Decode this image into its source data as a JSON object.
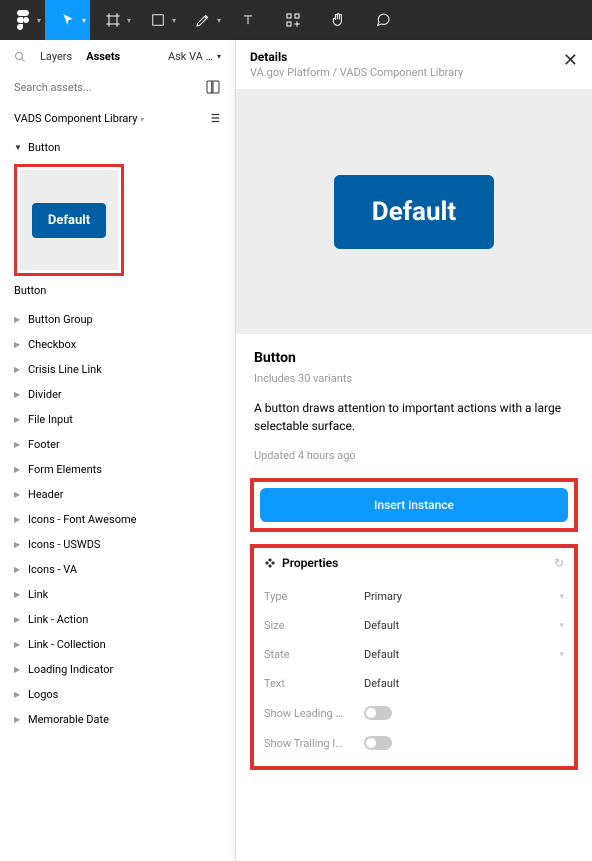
{
  "tabs": {
    "layers": "Layers",
    "assets": "Assets",
    "ask": "Ask VA …"
  },
  "search": {
    "placeholder": "Search assets..."
  },
  "library": {
    "name": "VADS Component Library"
  },
  "assets": {
    "button": "Button",
    "thumb_label": "Default",
    "thumb_caption": "Button",
    "items": [
      "Button Group",
      "Checkbox",
      "Crisis Line Link",
      "Divider",
      "File Input",
      "Footer",
      "Form Elements",
      "Header",
      "Icons - Font Awesome",
      "Icons - USWDS",
      "Icons - VA",
      "Link",
      "Link - Action",
      "Link - Collection",
      "Loading Indicator",
      "Logos",
      "Memorable Date"
    ]
  },
  "details": {
    "title": "Details",
    "breadcrumb": "VA.gov Platform / VADS Component Library",
    "preview_label": "Default",
    "name": "Button",
    "variants": "Includes 30 variants",
    "description": "A button draws attention to important actions with a large selectable surface.",
    "updated": "Updated 4 hours ago",
    "insert": "Insert instance",
    "properties": {
      "heading": "Properties",
      "rows": [
        {
          "label": "Type",
          "value": "Primary",
          "chev": true
        },
        {
          "label": "Size",
          "value": "Default",
          "chev": true
        },
        {
          "label": "State",
          "value": "Default",
          "chev": true
        },
        {
          "label": "Text",
          "value": "Default",
          "chev": false
        }
      ],
      "toggles": [
        {
          "label": "Show Leading …"
        },
        {
          "label": "Show Trailing I…"
        }
      ]
    }
  }
}
